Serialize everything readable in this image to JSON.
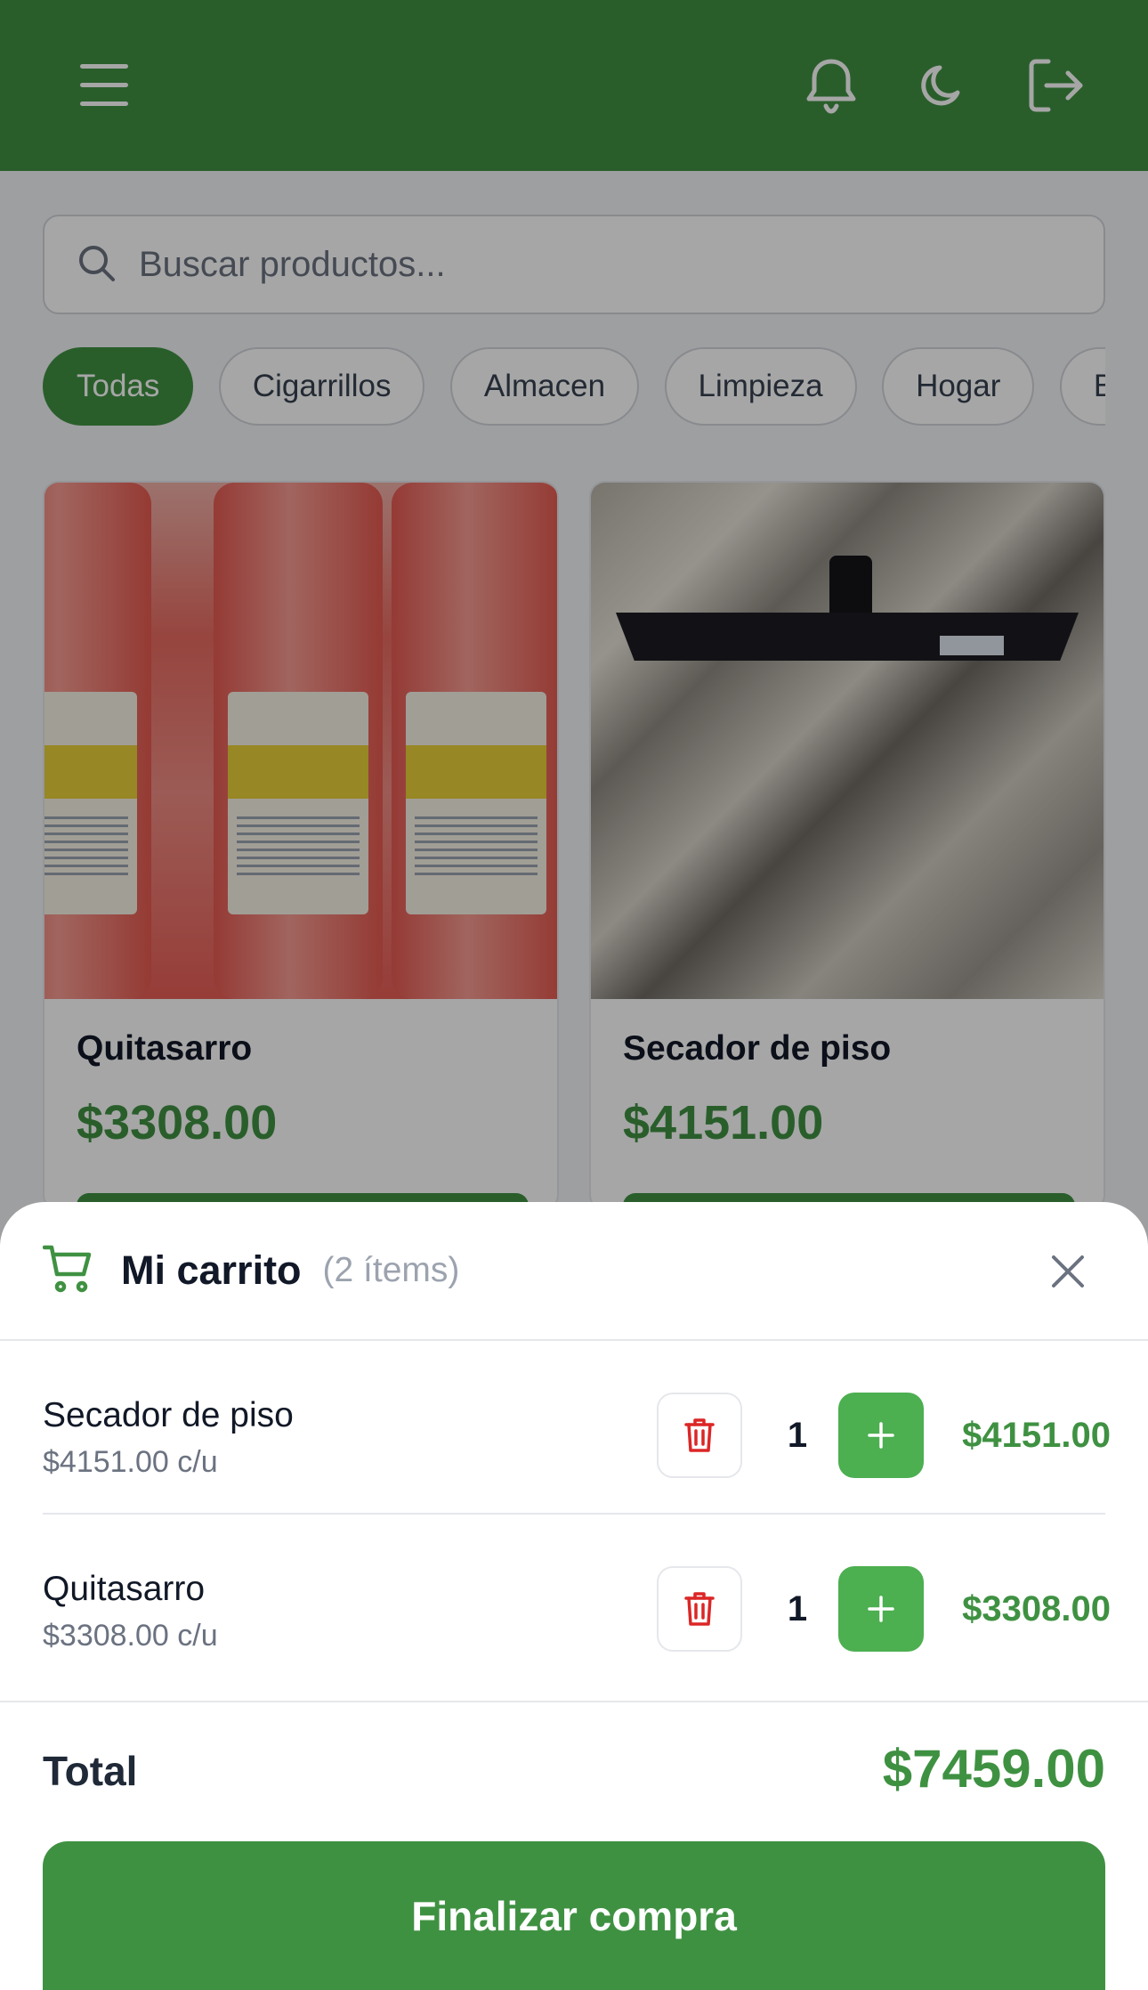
{
  "header": {
    "menu_icon": "menu-icon",
    "notification_icon": "bell-icon",
    "theme_icon": "moon-icon",
    "logout_icon": "logout-icon",
    "background_color": "#3f9142"
  },
  "search": {
    "placeholder": "Buscar productos...",
    "value": ""
  },
  "categories": [
    {
      "label": "Todas",
      "active": true
    },
    {
      "label": "Cigarrillos",
      "active": false
    },
    {
      "label": "Almacen",
      "active": false
    },
    {
      "label": "Limpieza",
      "active": false
    },
    {
      "label": "Hogar",
      "active": false
    },
    {
      "label": "B",
      "active": false
    }
  ],
  "products": [
    {
      "name": "Quitasarro",
      "price": "$3308.00"
    },
    {
      "name": "Secador de piso",
      "price": "$4151.00"
    }
  ],
  "cart": {
    "title": "Mi carrito",
    "count": "(2 ítems)",
    "items": [
      {
        "name": "Secador de piso",
        "unit_price": "$4151.00 c/u",
        "quantity": "1",
        "line_total": "$4151.00"
      },
      {
        "name": "Quitasarro",
        "unit_price": "$3308.00 c/u",
        "quantity": "1",
        "line_total": "$3308.00"
      }
    ],
    "total_label": "Total",
    "total_value": "$7459.00",
    "checkout_label": "Finalizar compra"
  },
  "colors": {
    "accent": "#3f9142",
    "accent_light": "#4caf50",
    "danger": "#dc2626"
  }
}
